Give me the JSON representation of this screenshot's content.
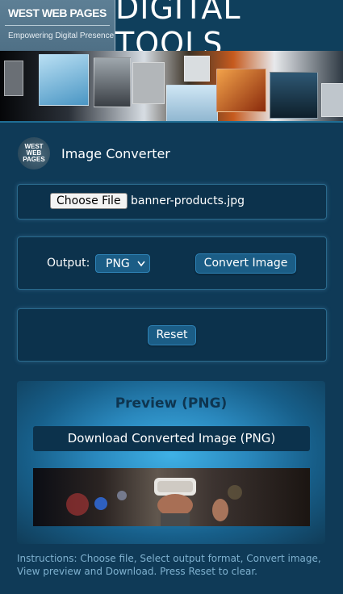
{
  "header": {
    "brand_name": "WEST WEB PAGES",
    "brand_tagline": "Empowering Digital Presence",
    "site_title": "DIGITAL TOOLS"
  },
  "app": {
    "logo_text": [
      "WEST",
      "WEB",
      "PAGES"
    ],
    "title": "Image Converter"
  },
  "file_panel": {
    "choose_file_label": "Choose File",
    "selected_file": "banner-products.jpg"
  },
  "convert_panel": {
    "output_label": "Output:",
    "output_value": "PNG",
    "convert_label": "Convert Image"
  },
  "reset_panel": {
    "reset_label": "Reset"
  },
  "preview": {
    "title": "Preview (PNG)",
    "download_label": "Download Converted Image (PNG)"
  },
  "instructions": "Instructions: Choose file, Select output format, Convert image, View preview and Download. Press Reset to clear.",
  "colors": {
    "page_bg": "#0f3a57",
    "panel_bg": "#0c324c",
    "button_bg": "#1b5d86",
    "instructions_text": "#7fb1cf",
    "preview_glow": "#3fb1e6"
  }
}
